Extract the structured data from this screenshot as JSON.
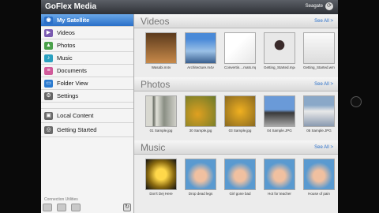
{
  "app": {
    "title": "GoFlex Media",
    "device_label": "Seagate"
  },
  "sidebar": {
    "items": [
      {
        "label": "My Satellite",
        "icon": "satellite-icon",
        "color": "#2a6fc8"
      },
      {
        "label": "Videos",
        "icon": "videos-icon",
        "color": "#7a5ab0"
      },
      {
        "label": "Photos",
        "icon": "photos-icon",
        "color": "#4aa04a"
      },
      {
        "label": "Music",
        "icon": "music-icon",
        "color": "#2aa0c0"
      },
      {
        "label": "Documents",
        "icon": "documents-icon",
        "color": "#d05a9a"
      },
      {
        "label": "Folder View",
        "icon": "folder-icon",
        "color": "#2a7ad0"
      },
      {
        "label": "Settings",
        "icon": "settings-icon",
        "color": "#666666"
      }
    ],
    "secondary": [
      {
        "label": "Local Content",
        "icon": "local-content-icon",
        "color": "#6a6a6a"
      },
      {
        "label": "Getting Started",
        "icon": "getting-started-icon",
        "color": "#6a6a6a"
      }
    ],
    "connection_label": "Connection Utilities"
  },
  "sections": {
    "videos": {
      "title": "Videos",
      "see_all": "See All >",
      "items": [
        "Wasabi.m4v",
        "Architecture.m4v",
        "Convertin....mats.mp4",
        "Getting_Started.mp4",
        "Getting_Started.wmv"
      ]
    },
    "photos": {
      "title": "Photos",
      "see_all": "See All >",
      "items": [
        "01 Sample.jpg",
        "30 Sample.jpg",
        "03 Sample.jpg",
        "04 Sample.JPG",
        "05 Sample.JPG"
      ]
    },
    "music": {
      "title": "Music",
      "see_all": "See All >",
      "items": [
        "Don't Dej Here",
        "Drop dead legs",
        "Girl gone bad",
        "Hot for teacher",
        "House of pain"
      ]
    }
  }
}
